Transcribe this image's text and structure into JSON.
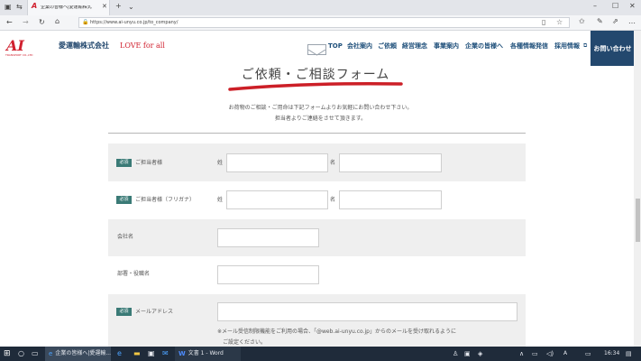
{
  "browser": {
    "tab_title": "企業の皆様へ|愛運輸株式",
    "url": "https://www.ai-unyu.co.jp/to_company/"
  },
  "site": {
    "logo_mark": "AI",
    "logo_sub": "TRANSPORT CO.,LTD",
    "company_name": "愛運輸株式会社",
    "tagline": "LOVE for all",
    "nav": [
      "TOP",
      "会社案内",
      "ご依頼",
      "経営理念",
      "事業案内",
      "企業の皆様へ",
      "各種情報発信",
      "採用情報"
    ],
    "contact_button": "お問い合わせ"
  },
  "form": {
    "title": "ご依頼・ご相談フォーム",
    "intro_line1": "お荷物のご相談・ご用命は下記フォームよりお気軽にお問い合わせ下さい。",
    "intro_line2": "担当者よりご連絡をさせて頂きます。",
    "required_badge": "必須",
    "fields": [
      {
        "label": "ご担当者様",
        "sub1": "姓",
        "sub2": "名"
      },
      {
        "label": "ご担当者様（フリガナ）",
        "sub1": "姓",
        "sub2": "名"
      },
      {
        "label": "会社名"
      },
      {
        "label": "部署・役職名"
      },
      {
        "label": "メールアドレス"
      }
    ],
    "email_note_line1": "※メール受信制限機能をご利用の場合、「@web.ai-unyu.co.jp」からのメールを受け取れるように",
    "email_note_line2": "ご設定ください。"
  },
  "taskbar": {
    "item1": "企業の皆様へ|愛運輸...",
    "item2": "文書 1 - Word",
    "lang": "A",
    "time": "16:34"
  },
  "colors": {
    "nav_text": "#1e4f7a",
    "contact_bg": "#23486e",
    "title_underline": "#cc1f27",
    "badge_bg": "#3a7a76",
    "logo_red": "#d0202e"
  }
}
